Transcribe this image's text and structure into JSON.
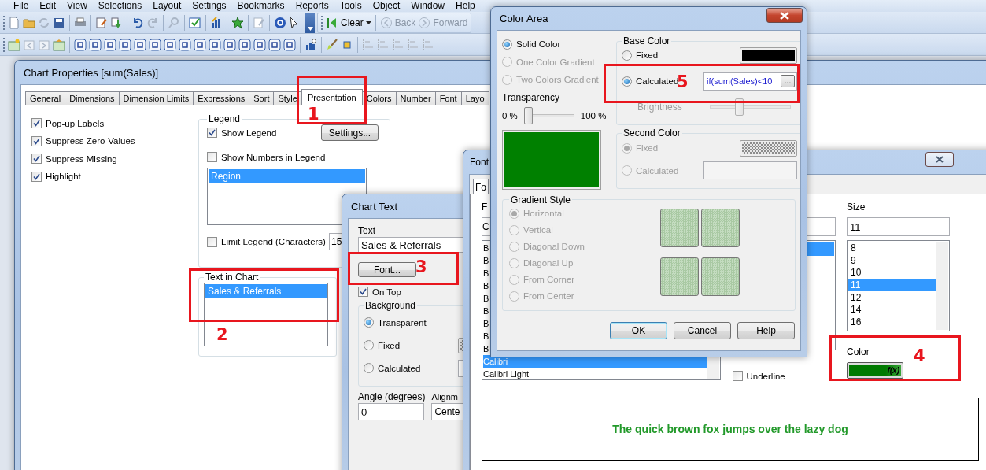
{
  "menu": [
    "File",
    "Edit",
    "View",
    "Selections",
    "Layout",
    "Settings",
    "Bookmarks",
    "Reports",
    "Tools",
    "Object",
    "Window",
    "Help"
  ],
  "toolbar": {
    "clear": "Clear",
    "back": "Back",
    "forward": "Forward"
  },
  "chart_properties": {
    "title": "Chart Properties [sum(Sales)]",
    "tabs": [
      {
        "label": "General",
        "selected": false
      },
      {
        "label": "Dimensions",
        "selected": false
      },
      {
        "label": "Dimension Limits",
        "selected": false
      },
      {
        "label": "Expressions",
        "selected": false
      },
      {
        "label": "Sort",
        "selected": false
      },
      {
        "label": "Style",
        "selected": false
      },
      {
        "label": "Presentation",
        "selected": true
      },
      {
        "label": "Colors",
        "selected": false
      },
      {
        "label": "Number",
        "selected": false
      },
      {
        "label": "Font",
        "selected": false
      },
      {
        "label": "Layo",
        "selected": false
      }
    ],
    "options": [
      {
        "label": "Pop-up Labels",
        "checked": true
      },
      {
        "label": "Suppress Zero-Values",
        "checked": true
      },
      {
        "label": "Suppress Missing",
        "checked": true
      },
      {
        "label": "Highlight",
        "checked": true
      }
    ],
    "legend": {
      "title": "Legend",
      "show_legend": {
        "label": "Show Legend",
        "checked": true
      },
      "settings_button": "Settings...",
      "show_numbers": {
        "label": "Show Numbers in Legend",
        "checked": false
      },
      "items": [
        {
          "label": "Region",
          "selected": true
        }
      ],
      "limit_legend": {
        "label": "Limit Legend (Characters)",
        "checked": false
      },
      "limit_value": "15"
    },
    "text_in_chart": {
      "title": "Text in Chart",
      "items": [
        {
          "label": "Sales & Referrals",
          "selected": true
        }
      ]
    }
  },
  "chart_text": {
    "title": "Chart Text",
    "text_label": "Text",
    "text_value": "Sales & Referrals",
    "font_button": "Font...",
    "on_top": {
      "label": "On Top",
      "checked": true
    },
    "background": {
      "title": "Background",
      "options": [
        {
          "label": "Transparent",
          "selected": true
        },
        {
          "label": "Fixed",
          "selected": false
        },
        {
          "label": "Calculated",
          "selected": false
        }
      ]
    },
    "angle_label": "Angle (degrees)",
    "angle_value": "0",
    "alignment_label": "Alignm",
    "alignment_value": "Cente"
  },
  "font_dialog": {
    "title": "Font",
    "tab": "Fo",
    "font_label": "F",
    "font_value": "C",
    "font_list": [
      {
        "label": "B",
        "selected": false
      },
      {
        "label": "B",
        "selected": false
      },
      {
        "label": "B",
        "selected": false
      },
      {
        "label": "B",
        "selected": false
      },
      {
        "label": "B",
        "selected": false
      },
      {
        "label": "B",
        "selected": false
      },
      {
        "label": "B",
        "selected": false
      },
      {
        "label": "B",
        "selected": false
      },
      {
        "label": "B",
        "selected": false
      },
      {
        "label": "Calibri",
        "selected": true
      },
      {
        "label": "Calibri Light",
        "selected": false
      }
    ],
    "style_list": [
      {
        "selected": true
      }
    ],
    "underline": {
      "label": "Underline",
      "checked": false
    },
    "size_label": "Size",
    "size_value": "11",
    "size_list": [
      {
        "label": "8",
        "selected": false
      },
      {
        "label": "9",
        "selected": false
      },
      {
        "label": "10",
        "selected": false
      },
      {
        "label": "11",
        "selected": true
      },
      {
        "label": "12",
        "selected": false
      },
      {
        "label": "14",
        "selected": false
      },
      {
        "label": "16",
        "selected": false
      }
    ],
    "color_label": "Color",
    "color_button": "f(x)",
    "preview": "The quick brown fox jumps over the lazy dog"
  },
  "color_area": {
    "title": "Color Area",
    "fill_modes": [
      {
        "label": "Solid Color",
        "selected": true,
        "disabled": false
      },
      {
        "label": "One Color Gradient",
        "selected": false,
        "disabled": true
      },
      {
        "label": "Two Colors Gradient",
        "selected": false,
        "disabled": true
      }
    ],
    "transparency": {
      "label": "Transparency",
      "min": "0 %",
      "max": "100 %",
      "level": 0
    },
    "base_color": {
      "title": "Base Color",
      "options": [
        {
          "label": "Fixed",
          "selected": false,
          "disabled": false
        },
        {
          "label": "Calculated",
          "selected": true,
          "disabled": false
        }
      ],
      "expression": "if(sum(Sales)<10",
      "expression_button": "...",
      "brightness": {
        "label": "Brightness",
        "disabled": true,
        "level": 0.35
      }
    },
    "second_color": {
      "title": "Second Color",
      "options": [
        {
          "label": "Fixed",
          "selected": true,
          "disabled": true
        },
        {
          "label": "Calculated",
          "selected": false,
          "disabled": true
        }
      ]
    },
    "gradient_style": {
      "title": "Gradient Style",
      "options": [
        {
          "label": "Horizontal",
          "selected": true,
          "disabled": true
        },
        {
          "label": "Vertical",
          "selected": false,
          "disabled": true
        },
        {
          "label": "Diagonal Down",
          "selected": false,
          "disabled": true
        },
        {
          "label": "Diagonal Up",
          "selected": false,
          "disabled": true
        },
        {
          "label": "From Corner",
          "selected": false,
          "disabled": true
        },
        {
          "label": "From Center",
          "selected": false,
          "disabled": true
        }
      ]
    },
    "buttons": [
      "OK",
      "Cancel",
      "Help"
    ]
  },
  "annotations": [
    {
      "label": "1"
    },
    {
      "label": "2"
    },
    {
      "label": "3"
    },
    {
      "label": "4"
    },
    {
      "label": "5"
    }
  ]
}
